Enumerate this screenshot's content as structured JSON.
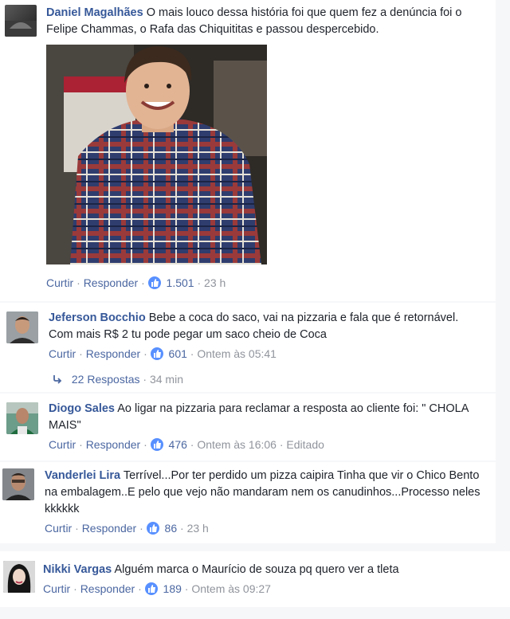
{
  "comments": [
    {
      "author": "Daniel Magalhães",
      "text": "O mais louco dessa história foi que quem fez a denúncia foi o Felipe Chammas, o Rafa das Chiquititas e passou despercebido.",
      "like_label": "Curtir",
      "reply_label": "Responder",
      "reactions": "1.501",
      "time": "23 h"
    },
    {
      "author": "Jeferson Bocchio",
      "text": "Bebe a coca do saco, vai na pizzaria e fala que é retornável. Com mais R$ 2 tu pode pegar um saco cheio de Coca",
      "like_label": "Curtir",
      "reply_label": "Responder",
      "reactions": "601",
      "time": "Ontem às 05:41",
      "replies_label": "22 Respostas",
      "replies_time": "34 min"
    },
    {
      "author": "Diogo Sales",
      "text": "Ao ligar na pizzaria para reclamar a resposta ao cliente foi: \" CHOLA MAIS\"",
      "like_label": "Curtir",
      "reply_label": "Responder",
      "reactions": "476",
      "time": "Ontem às 16:06",
      "edited": "Editado"
    },
    {
      "author": "Vanderlei Lira",
      "text": "Terrível...Por ter perdido um pizza caipira Tinha que vir o Chico Bento na embalagem..E pelo que vejo não mandaram nem os canudinhos...Processo neles kkkkkk",
      "like_label": "Curtir",
      "reply_label": "Responder",
      "reactions": "86",
      "time": "23 h"
    },
    {
      "author": "Nikki Vargas",
      "text": "Alguém marca o Maurício de souza pq quero ver a tleta",
      "like_label": "Curtir",
      "reply_label": "Responder",
      "reactions": "189",
      "time": "Ontem às 09:27"
    }
  ],
  "colors": {
    "link": "#365899",
    "meta": "#90949c",
    "like_badge": "#5890ff"
  },
  "icons": [
    "like-thumb-icon",
    "reply-arrow-icon"
  ]
}
